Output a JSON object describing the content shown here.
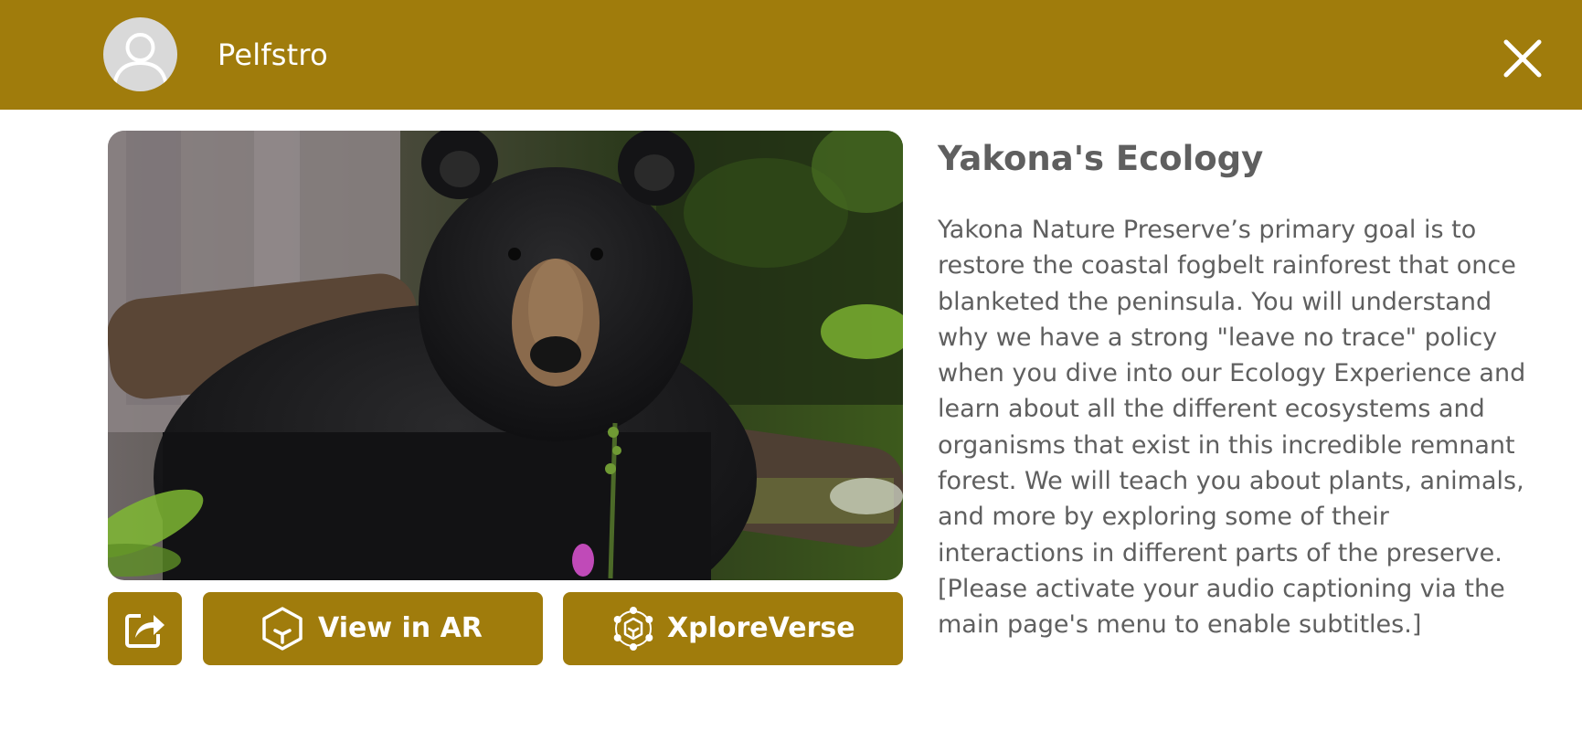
{
  "header": {
    "username": "Pelfstro",
    "avatar_icon": "user-icon",
    "close_icon": "close-icon",
    "bg_color": "#a07c0c"
  },
  "media": {
    "image_subject": "black bear in forest"
  },
  "actions": {
    "share_icon": "share-icon",
    "view_ar_label": "View in AR",
    "view_ar_icon": "ar-cube-icon",
    "xploreverse_label": "XploreVerse",
    "xploreverse_icon": "xploreverse-icon"
  },
  "content": {
    "title": "Yakona's Ecology",
    "description": "Yakona Nature Preserve’s primary goal is to restore the coastal fogbelt rainforest that once blanketed the peninsula. You will understand why we have a strong \"leave no trace\" policy when you dive into our Ecology Experience and learn about all the different ecosystems and organisms that exist in this incredible remnant forest. We will teach you about plants, animals, and more by exploring some of their interactions in different parts of the preserve. [Please activate your audio captioning via the main page's menu to enable subtitles.]"
  },
  "colors": {
    "accent": "#a07c0c",
    "text": "#5f5f5f",
    "background": "#ffffff"
  }
}
